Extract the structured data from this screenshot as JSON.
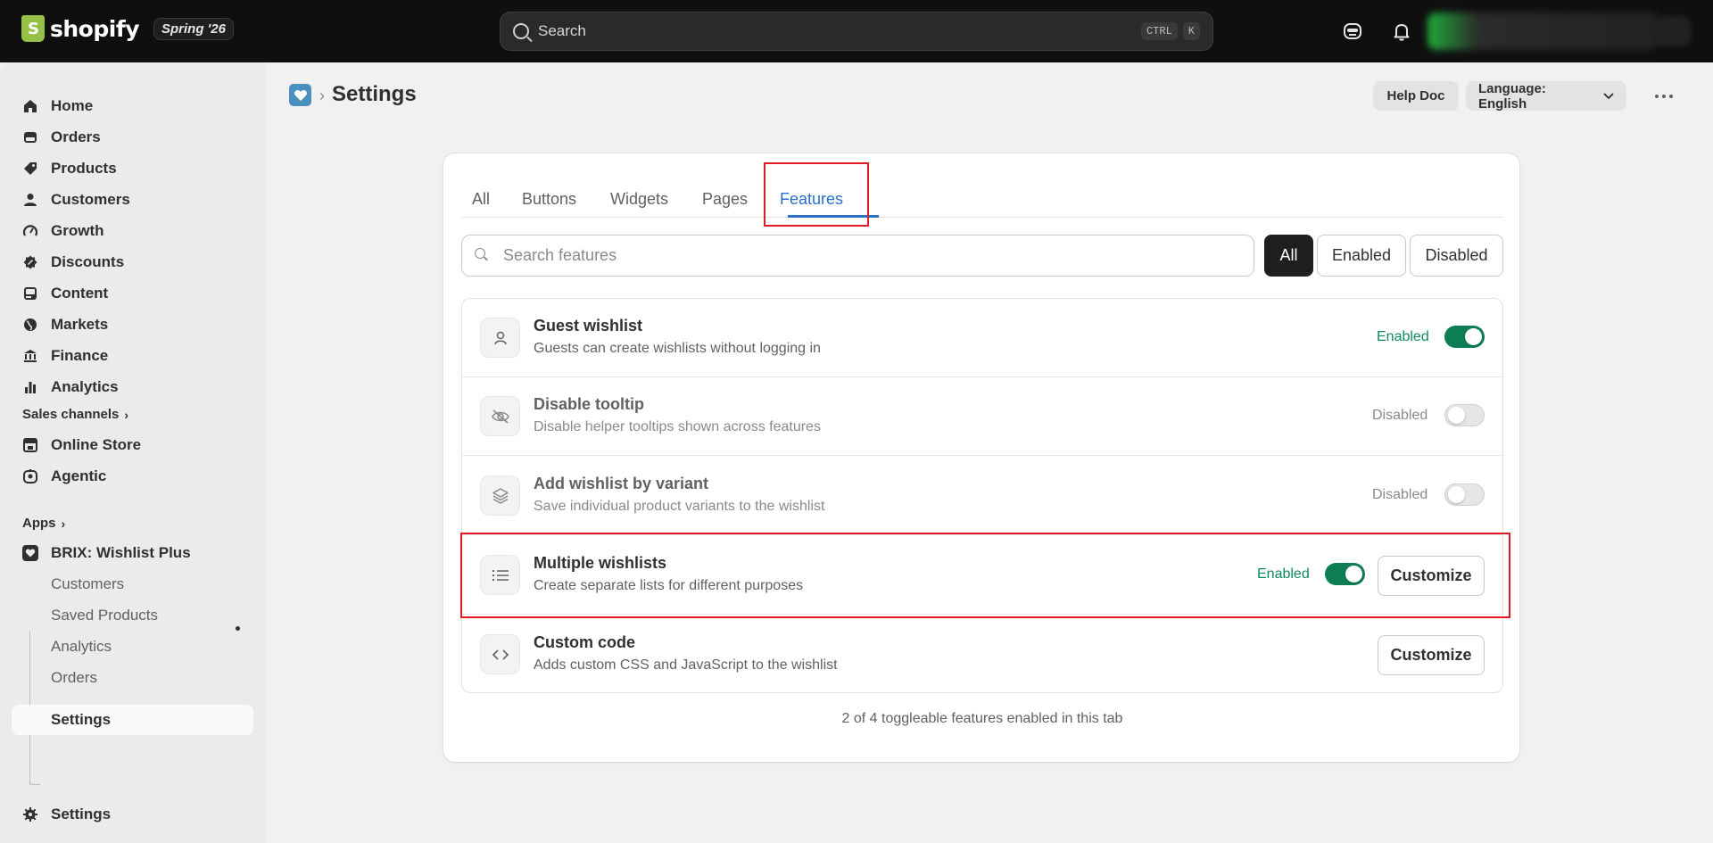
{
  "topbar": {
    "brand": "shopify",
    "edition": "Spring '26",
    "search_placeholder": "Search",
    "shortcut_ctrl": "CTRL",
    "shortcut_key": "K"
  },
  "sidebar": {
    "items": [
      {
        "label": "Home",
        "icon": "home-icon"
      },
      {
        "label": "Orders",
        "icon": "orders-icon"
      },
      {
        "label": "Products",
        "icon": "tag-icon"
      },
      {
        "label": "Customers",
        "icon": "person-icon"
      },
      {
        "label": "Growth",
        "icon": "gauge-icon"
      },
      {
        "label": "Discounts",
        "icon": "discount-icon"
      },
      {
        "label": "Content",
        "icon": "image-icon"
      },
      {
        "label": "Markets",
        "icon": "globe-icon"
      },
      {
        "label": "Finance",
        "icon": "bank-icon"
      },
      {
        "label": "Analytics",
        "icon": "bar-chart-icon"
      }
    ],
    "sales_channels_title": "Sales channels",
    "sales_channels": [
      {
        "label": "Online Store",
        "icon": "store-icon"
      },
      {
        "label": "Agentic",
        "icon": "agent-icon"
      }
    ],
    "apps_title": "Apps",
    "app": {
      "label": "BRIX: Wishlist Plus",
      "icon": "wishlist-app-icon"
    },
    "app_subitems": [
      {
        "label": "Customers"
      },
      {
        "label": "Saved Products"
      },
      {
        "label": "Analytics"
      },
      {
        "label": "Orders"
      },
      {
        "label": "Settings",
        "active": true
      }
    ],
    "settings": {
      "label": "Settings",
      "icon": "gear-icon"
    }
  },
  "header": {
    "title": "Settings",
    "help_doc": "Help Doc",
    "language": "Language: English"
  },
  "tabs": [
    {
      "label": "All"
    },
    {
      "label": "Buttons"
    },
    {
      "label": "Widgets"
    },
    {
      "label": "Pages"
    },
    {
      "label": "Features",
      "active": true
    }
  ],
  "search": {
    "placeholder": "Search features",
    "value": ""
  },
  "filters": [
    {
      "label": "All",
      "active": true
    },
    {
      "label": "Enabled"
    },
    {
      "label": "Disabled"
    }
  ],
  "features": [
    {
      "title": "Guest wishlist",
      "description": "Guests can create wishlists without logging in",
      "status": "Enabled",
      "enabled": true,
      "icon": "person-icon",
      "customize": null
    },
    {
      "title": "Disable tooltip",
      "description": "Disable helper tooltips shown across features",
      "status": "Disabled",
      "enabled": false,
      "icon": "eye-off-icon",
      "customize": null
    },
    {
      "title": "Add wishlist by variant",
      "description": "Save individual product variants to the wishlist",
      "status": "Disabled",
      "enabled": false,
      "icon": "layers-icon",
      "customize": null
    },
    {
      "title": "Multiple wishlists",
      "description": "Create separate lists for different purposes",
      "status": "Enabled",
      "enabled": true,
      "icon": "list-icon",
      "customize": "Customize"
    },
    {
      "title": "Custom code",
      "description": "Adds custom CSS and JavaScript to the wishlist",
      "status": null,
      "enabled": null,
      "icon": "code-icon",
      "customize": "Customize"
    }
  ],
  "footer_note": "2 of 4 toggleable features enabled in this tab",
  "colors": {
    "accent": "#2c6ecb",
    "toggle_on": "#0d7e54",
    "enabled_text": "#0e8a5f",
    "highlight": "#e01b24"
  }
}
